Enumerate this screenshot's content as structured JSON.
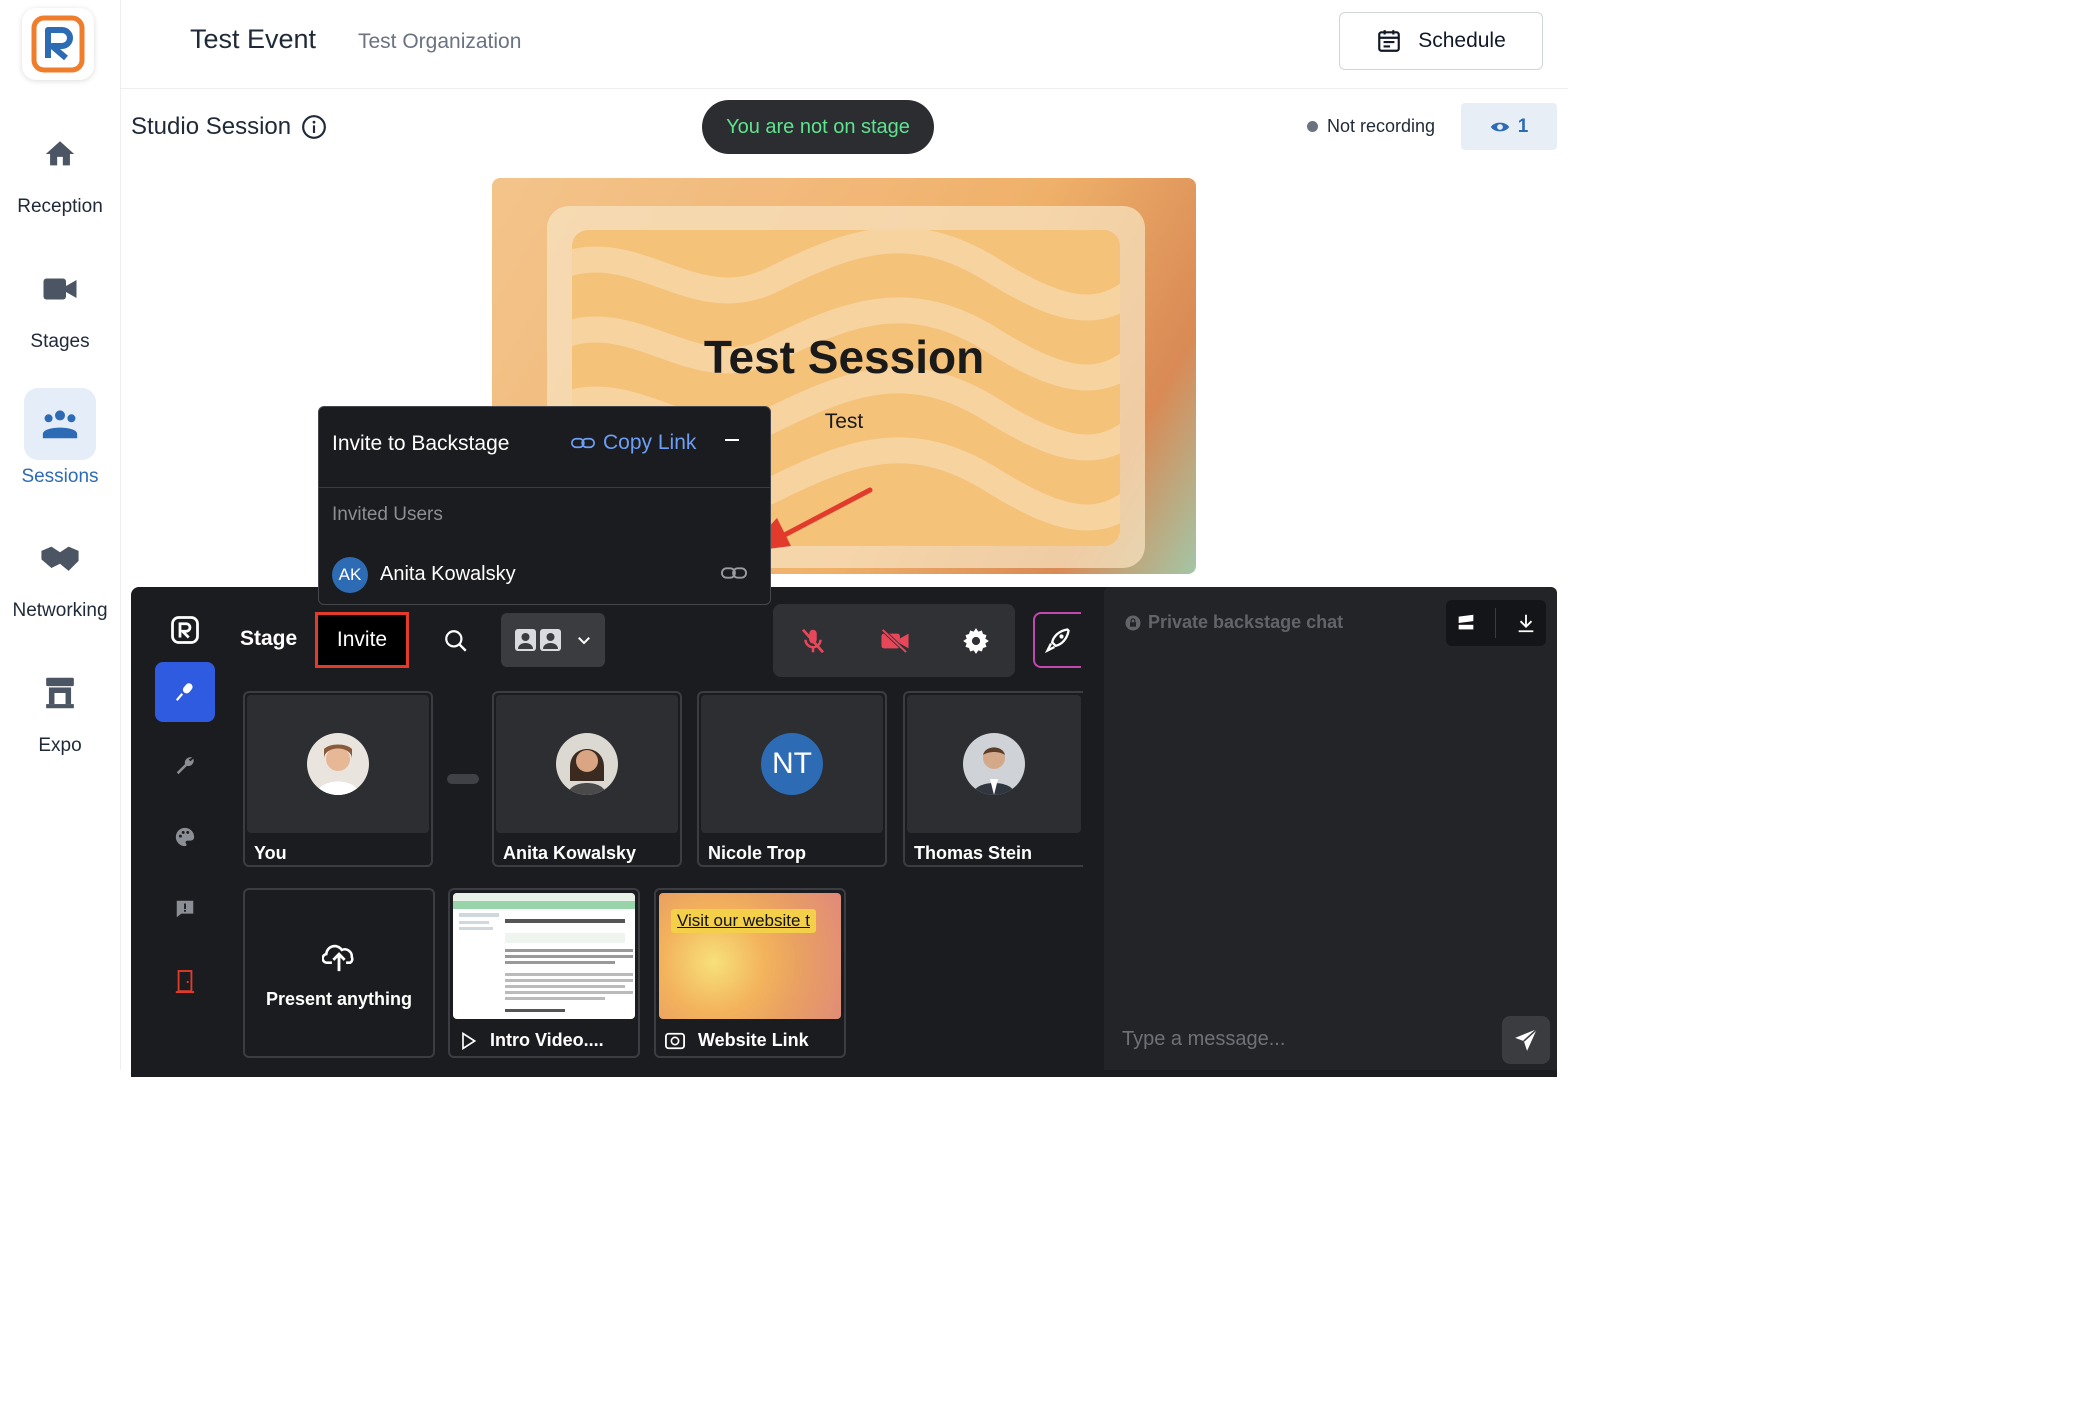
{
  "header": {
    "event_title": "Test Event",
    "organization": "Test Organization",
    "schedule_label": "Schedule"
  },
  "nav": {
    "items": [
      {
        "label": "Reception",
        "icon": "home-icon"
      },
      {
        "label": "Stages",
        "icon": "video-camera-icon"
      },
      {
        "label": "Sessions",
        "icon": "people-icon",
        "active": true
      },
      {
        "label": "Networking",
        "icon": "handshake-icon"
      },
      {
        "label": "Expo",
        "icon": "storefront-icon"
      }
    ]
  },
  "session": {
    "title": "Studio Session",
    "stage_status": "You are not on stage",
    "recording_status": "Not recording",
    "viewer_count": "1"
  },
  "slide": {
    "title": "Test Session",
    "subtitle": "Test"
  },
  "popup": {
    "title": "Invite to Backstage",
    "copy_link_label": "Copy Link",
    "invited_header": "Invited Users",
    "users": [
      {
        "initials": "AK",
        "name": "Anita Kowalsky"
      }
    ]
  },
  "backstage": {
    "stage_label": "Stage",
    "invite_label": "Invite",
    "participants": [
      {
        "name": "You"
      },
      {
        "name": "Anita Kowalsky"
      },
      {
        "name": "Nicole Trop",
        "initials": "NT"
      },
      {
        "name": "Thomas Stein"
      }
    ],
    "present_label": "Present anything",
    "media": [
      {
        "caption": "Intro Video...."
      },
      {
        "caption": "Website Link",
        "banner": "Visit our website t"
      }
    ]
  },
  "chat": {
    "header": "Private backstage chat",
    "placeholder": "Type a message..."
  },
  "colors": {
    "accent_blue": "#2d6bb5",
    "panel_bg": "#1b1c1f",
    "on_stage_green": "#5ee38f",
    "highlight_red": "#e23a2b",
    "active_sidebar": "#2f5be0"
  }
}
